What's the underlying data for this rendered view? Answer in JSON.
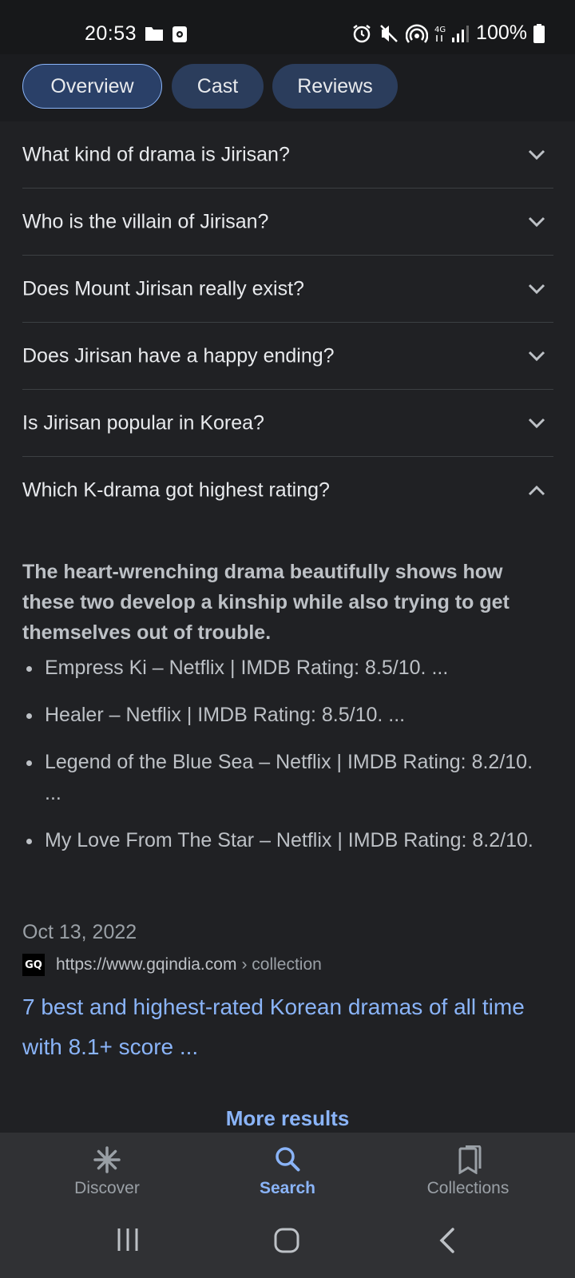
{
  "status_bar": {
    "time": "20:53",
    "battery": "100%",
    "icons": [
      "folder-icon",
      "screenshot-icon",
      "alarm-icon",
      "mute-icon",
      "hotspot-icon",
      "4g-signal-icon",
      "battery-icon"
    ]
  },
  "tabs": [
    {
      "label": "Overview",
      "active": true
    },
    {
      "label": "Cast",
      "active": false
    },
    {
      "label": "Reviews",
      "active": false
    }
  ],
  "faq": [
    {
      "question": "What kind of drama is Jirisan?",
      "expanded": false
    },
    {
      "question": "Who is the villain of Jirisan?",
      "expanded": false
    },
    {
      "question": "Does Mount Jirisan really exist?",
      "expanded": false
    },
    {
      "question": "Does Jirisan have a happy ending?",
      "expanded": false
    },
    {
      "question": "Is Jirisan popular in Korea?",
      "expanded": false
    },
    {
      "question": "Which K-drama got highest rating?",
      "expanded": true
    }
  ],
  "answer": {
    "lead": "The heart-wrenching drama beautifully shows how these two develop a kinship while also trying to get themselves out of trouble.",
    "items": [
      "Empress Ki – Netflix | IMDB Rating: 8.5/10. ...",
      "Healer – Netflix | IMDB Rating: 8.5/10. ...",
      "Legend of the Blue Sea – Netflix | IMDB Rating: 8.2/10. ...",
      "My Love From The Star – Netflix | IMDB Rating: 8.2/10."
    ],
    "date": "Oct 13, 2022",
    "source_favicon": "GQ",
    "source_url": "https://www.gqindia.com",
    "source_crumb": "› collection",
    "result_title": "7 best and highest-rated Korean dramas of all time with 8.1+ score ..."
  },
  "more_results": "More results",
  "bottom_nav": [
    {
      "label": "Discover",
      "icon": "discover-icon",
      "active": false
    },
    {
      "label": "Search",
      "icon": "search-icon",
      "active": true
    },
    {
      "label": "Collections",
      "icon": "collections-icon",
      "active": false
    }
  ],
  "colors": {
    "background": "#202124",
    "accent": "#8ab4f8",
    "chip": "#2b3d5c",
    "text": "#e8eaed",
    "muted": "#9aa0a6"
  }
}
